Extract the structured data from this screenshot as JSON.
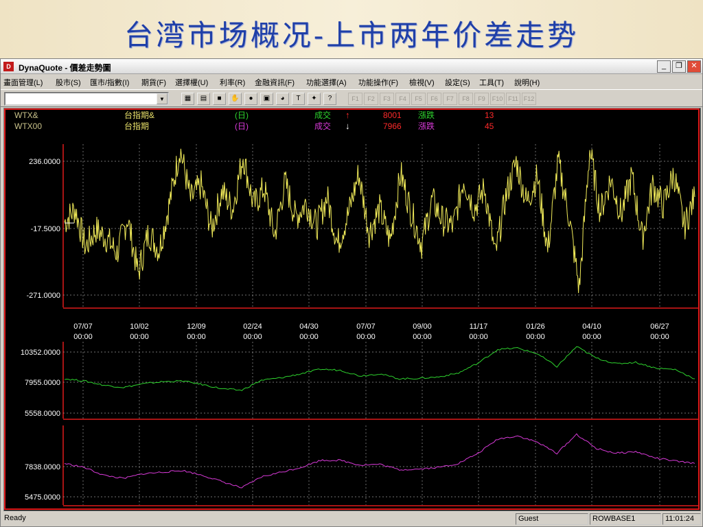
{
  "slide": {
    "title": "台湾市场概况-上市两年价差走势"
  },
  "window": {
    "title": "DynaQuote - 價差走勢圖",
    "icon": "app-logo-icon"
  },
  "window_controls": {
    "minimize": "_",
    "maximize": "❐",
    "close": "✕"
  },
  "menu": {
    "items": [
      "畫面管理(L)",
      "股市(S)",
      "匯市/指數(I)",
      "期貨(F)",
      "選擇權(U)",
      "利率(R)",
      "金融資訊(F)",
      "功能選擇(A)",
      "功能操作(F)",
      "檢視(V)",
      "設定(S)",
      "工具(T)",
      "說明(H)"
    ]
  },
  "toolbar": {
    "symbol_value": "",
    "combo_arrow": "▼",
    "icons": [
      "new-chart-icon",
      "window-icon",
      "color-icon",
      "hand-icon",
      "alert-icon",
      "report-icon",
      "palette-icon",
      "text-icon",
      "settings-icon",
      "help-icon"
    ],
    "icon_glyphs": [
      "▦",
      "▤",
      "■",
      "✋",
      "●",
      "▣",
      "◕",
      "T",
      "✦",
      "?"
    ],
    "fkeys": [
      "F1",
      "F2",
      "F3",
      "F4",
      "F5",
      "F6",
      "F7",
      "F8",
      "F9",
      "F10",
      "F11",
      "F12"
    ]
  },
  "legend": {
    "rows": [
      {
        "code": "WTX&",
        "name": "台指期&",
        "period": "(日)",
        "trade_label": "成交",
        "arrow": "↑",
        "price": "8001",
        "change_label": "漲跌",
        "change": "13"
      },
      {
        "code": "WTX00",
        "name": "台指期",
        "period": "(日)",
        "trade_label": "成交",
        "arrow": "↓",
        "price": "7966",
        "change_label": "漲跌",
        "change": "45"
      }
    ]
  },
  "colors": {
    "spread": "#f2ec5a",
    "series1": "#2ed32e",
    "series2": "#d93ad9",
    "frame": "#e01a1a",
    "axis_text": "#ffffff",
    "grid": "#9a9a9a",
    "up": "#ff2a2a",
    "down": "#ffffff",
    "code_text": "#c9c28a",
    "name_text": "#e8e06a",
    "period1": "#2ed32e",
    "period2": "#d93ad9",
    "trade1": "#2ed32e",
    "trade2": "#d93ad9",
    "number": "#ff2a2a",
    "change_label1": "#2ed32e",
    "change_label2": "#d93ad9"
  },
  "chart_data": [
    {
      "type": "line",
      "series": [
        {
          "values": [
            -5,
            40,
            -90,
            -30,
            -60,
            -110,
            10,
            -180,
            -40,
            -100,
            60,
            245,
            70,
            120,
            -30,
            100,
            40,
            220,
            50,
            110,
            -50,
            130,
            10,
            60,
            -20,
            80,
            -80,
            20,
            160,
            -40,
            40,
            -70,
            160,
            30,
            -80,
            70,
            0,
            -20,
            140,
            40,
            110,
            -120,
            80,
            200,
            60,
            150,
            -100,
            200,
            20,
            -230,
            240,
            30,
            140,
            20,
            150,
            -60,
            120,
            50,
            160,
            -20,
            80
          ]
        }
      ],
      "ylim": [
        -280,
        245
      ],
      "yticks": [
        "236.0000",
        "-17.5000",
        "-271.0000"
      ],
      "xticks": [
        [
          "07/07",
          "00:00"
        ],
        [
          "10/02",
          "00:00"
        ],
        [
          "12/09",
          "00:00"
        ],
        [
          "02/24",
          "00:00"
        ],
        [
          "04/30",
          "00:00"
        ],
        [
          "07/07",
          "00:00"
        ],
        [
          "09/00",
          "00:00"
        ],
        [
          "11/17",
          "00:00"
        ],
        [
          "01/26",
          "00:00"
        ],
        [
          "04/10",
          "00:00"
        ],
        [
          "06/27",
          "00:00"
        ]
      ]
    },
    {
      "type": "line",
      "series": [
        {
          "values": [
            8050,
            7900,
            7600,
            7450,
            7700,
            7850,
            7900,
            7650,
            7350,
            7250,
            7950,
            8120,
            8400,
            8720,
            8650,
            8250,
            8400,
            8050,
            8080,
            8180,
            8450,
            9150,
            10100,
            10200,
            9800,
            8900,
            10300,
            9500,
            9100,
            9200,
            8800,
            8700,
            8050
          ]
        }
      ],
      "ylim": [
        5558,
        10352
      ],
      "yticks": [
        "10352.0000",
        "7955.0000",
        "5558.0000"
      ]
    },
    {
      "type": "line",
      "series": [
        {
          "values": [
            7850,
            7600,
            7100,
            6900,
            7200,
            7300,
            7400,
            7100,
            6700,
            6300,
            7000,
            7300,
            7600,
            8050,
            8050,
            7750,
            7800,
            7450,
            7500,
            7600,
            7850,
            8500,
            9400,
            9600,
            9200,
            8500,
            9700,
            8800,
            8500,
            8600,
            8200,
            8000,
            7850
          ]
        }
      ],
      "ylim": [
        5475,
        10000
      ],
      "yticks": [
        "7838.0000",
        "5475.0000"
      ]
    }
  ],
  "status": {
    "ready": "Ready",
    "user": "Guest",
    "server": "ROWBASE1",
    "time": "11:01:24"
  }
}
